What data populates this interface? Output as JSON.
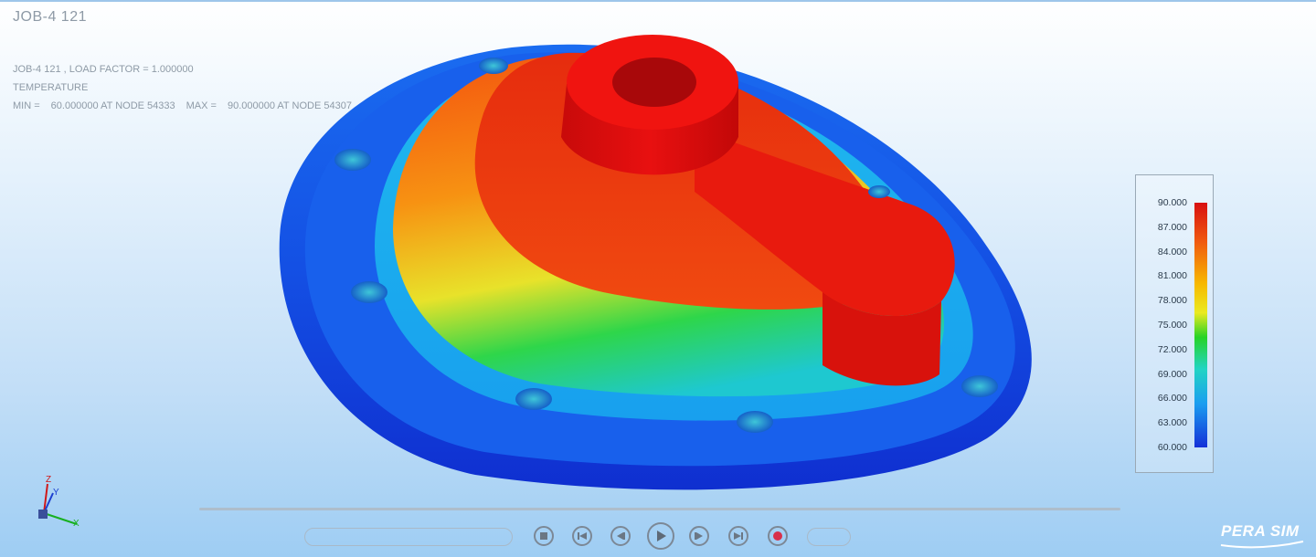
{
  "window": {
    "title": "JOB-4 121"
  },
  "info": {
    "line1": "JOB-4 121 , LOAD FACTOR = 1.000000",
    "line2": "TEMPERATURE",
    "min_label": "MIN =",
    "min_value": "60.000000 AT NODE 54333",
    "max_label": "MAX =",
    "max_value": "90.000000 AT NODE 54307"
  },
  "legend": {
    "ticks": [
      "90.000",
      "87.000",
      "84.000",
      "81.000",
      "78.000",
      "75.000",
      "72.000",
      "69.000",
      "66.000",
      "63.000",
      "60.000"
    ]
  },
  "colors": {
    "hot": "#d81010",
    "warm": "#f05a10",
    "mid": "#eaea20",
    "green": "#26d326",
    "cyan": "#22d4c4",
    "cold": "#1430d8"
  },
  "triad": {
    "z": "Z",
    "y": "Y",
    "x": "X"
  },
  "player": {
    "frame_field": "",
    "speed_field": "",
    "counter": "",
    "icons": [
      "stop-icon",
      "skip-first-icon",
      "step-back-icon",
      "play-icon",
      "step-forward-icon",
      "skip-last-icon",
      "record-icon"
    ]
  },
  "brand": {
    "logo": "PERA SIM"
  }
}
